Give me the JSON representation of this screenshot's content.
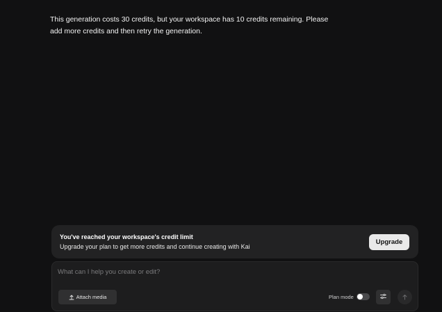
{
  "conversation": {
    "assistant_message": "This generation costs 30 credits, but your workspace has 10 credits remaining. Please add more credits and then retry the generation."
  },
  "credit_banner": {
    "title": "You've reached your workspace's credit limit",
    "subtitle": "Upgrade your plan to get more credits and continue creating with Kai",
    "upgrade_label": "Upgrade"
  },
  "composer": {
    "placeholder": "What can I help you create or edit?",
    "value": "",
    "attach_label": "Attach media",
    "plan_mode_label": "Plan mode",
    "plan_mode_enabled": false
  },
  "icons": {
    "attach": "upload-icon",
    "settings": "sliders-icon",
    "send": "arrow-up-icon"
  },
  "colors": {
    "background": "#111112",
    "banner": "#222223",
    "composer": "#1d1d1e",
    "upgrade_button": "#e9e9e9"
  }
}
